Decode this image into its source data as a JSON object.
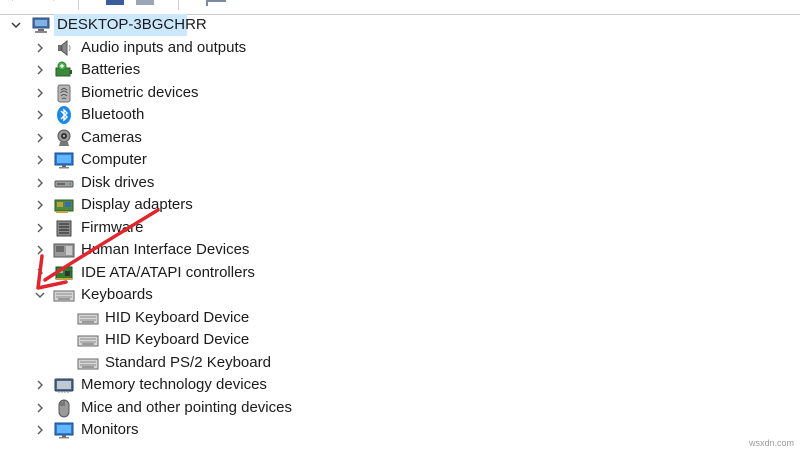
{
  "root": {
    "label": "DESKTOP-3BGCHRR",
    "icon": "computer-icon",
    "expanded": true
  },
  "categories": [
    {
      "label": "Audio inputs and outputs",
      "icon": "speaker-icon",
      "expanded": false
    },
    {
      "label": "Batteries",
      "icon": "battery-icon",
      "expanded": false
    },
    {
      "label": "Biometric devices",
      "icon": "fingerprint-icon",
      "expanded": false
    },
    {
      "label": "Bluetooth",
      "icon": "bluetooth-icon",
      "expanded": false
    },
    {
      "label": "Cameras",
      "icon": "camera-icon",
      "expanded": false
    },
    {
      "label": "Computer",
      "icon": "monitor-icon",
      "expanded": false
    },
    {
      "label": "Disk drives",
      "icon": "disk-drive-icon",
      "expanded": false
    },
    {
      "label": "Display adapters",
      "icon": "display-adapter-icon",
      "expanded": false
    },
    {
      "label": "Firmware",
      "icon": "firmware-icon",
      "expanded": false
    },
    {
      "label": "Human Interface Devices",
      "icon": "hid-icon",
      "expanded": false
    },
    {
      "label": "IDE ATA/ATAPI controllers",
      "icon": "ide-controller-icon",
      "expanded": false
    },
    {
      "label": "Keyboards",
      "icon": "keyboard-icon",
      "expanded": true,
      "children": [
        {
          "label": "HID Keyboard Device",
          "icon": "keyboard-icon"
        },
        {
          "label": "HID Keyboard Device",
          "icon": "keyboard-icon"
        },
        {
          "label": "Standard PS/2 Keyboard",
          "icon": "keyboard-icon"
        }
      ]
    },
    {
      "label": "Memory technology devices",
      "icon": "memory-icon",
      "expanded": false
    },
    {
      "label": "Mice and other pointing devices",
      "icon": "mouse-icon",
      "expanded": false
    },
    {
      "label": "Monitors",
      "icon": "monitor-icon",
      "expanded": false
    }
  ],
  "watermark": "wsxdn.com",
  "colors": {
    "selection": "#cce8ff",
    "annotation_arrow": "#e0262d",
    "chevron": "#5a5a5a"
  }
}
